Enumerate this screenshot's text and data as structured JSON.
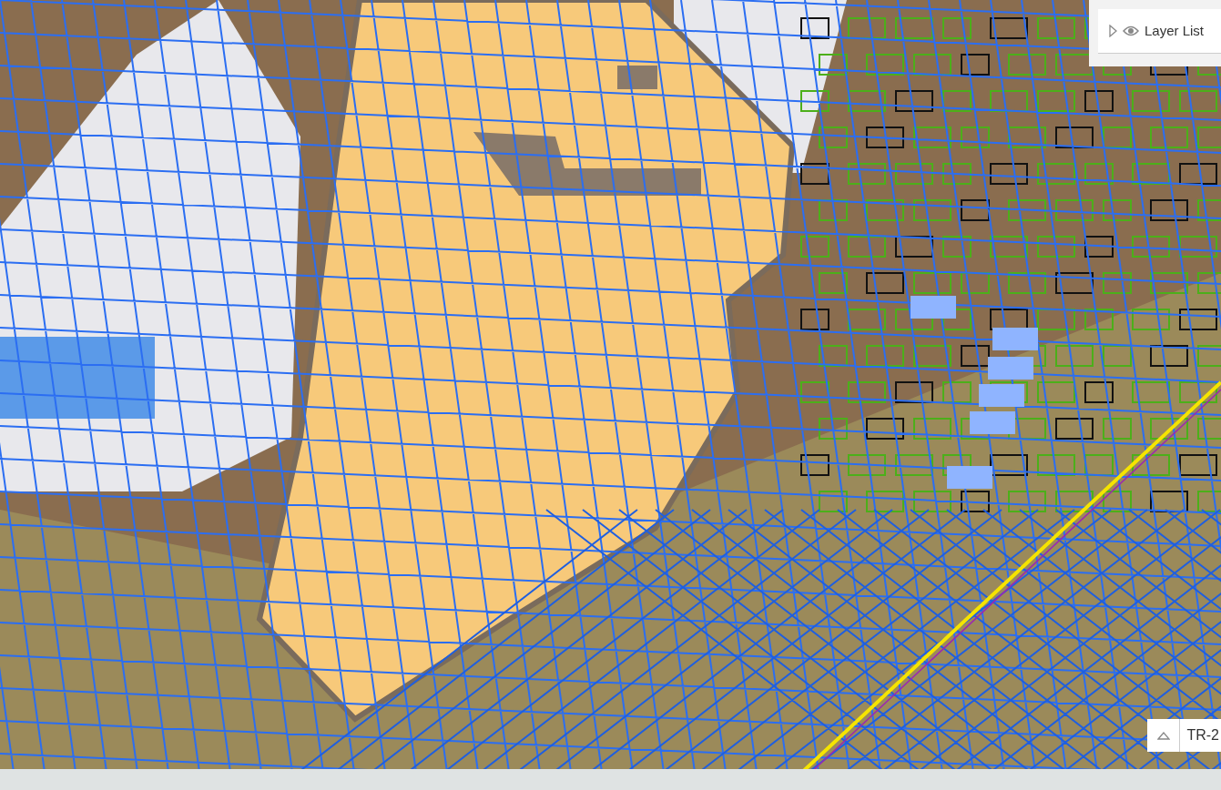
{
  "layer_list": {
    "title": "Layer List",
    "expanded": false
  },
  "attribute_table": {
    "label": "TR-2",
    "expanded": false
  }
}
